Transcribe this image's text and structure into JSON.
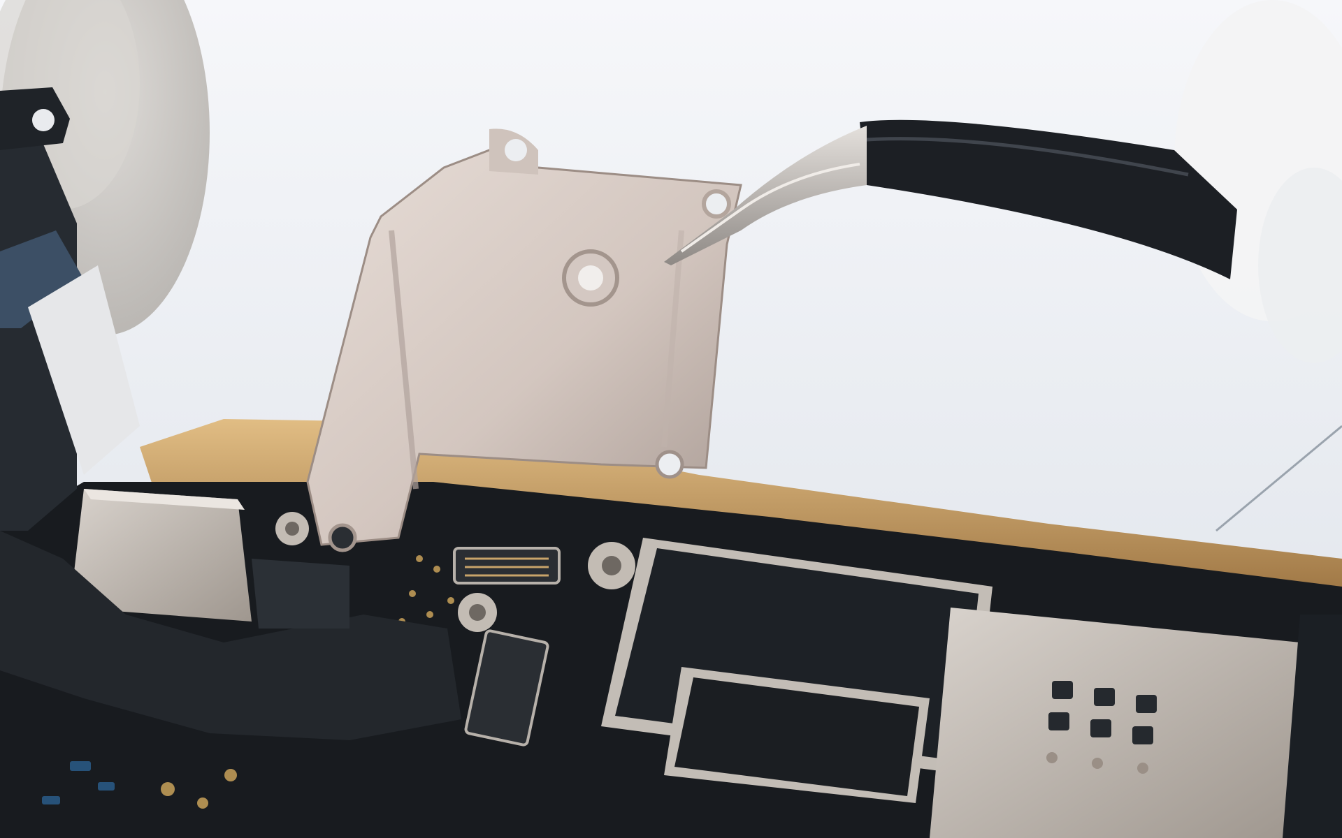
{
  "colors": {
    "background_top": "#f6f7fa",
    "background_bottom": "#dde2e9",
    "glove": "#c9c6c2",
    "bracket_light": "#ddd2cc",
    "bracket_dark": "#a89a93",
    "tweezer_metal": "#b9b4b0",
    "tweezer_grip": "#1c1f24",
    "gold_frame": "#c49a5c",
    "board": "#181b1f",
    "chip_black": "#1d2126",
    "shield_silver": "#c7c1bb",
    "flex_cable": "#23272c"
  },
  "icons": [
    "glove-left",
    "glove-right",
    "tweezers",
    "emi-shield-bracket",
    "logic-board",
    "gold-phone-frame",
    "flex-cable",
    "metal-shield-can",
    "chip"
  ]
}
